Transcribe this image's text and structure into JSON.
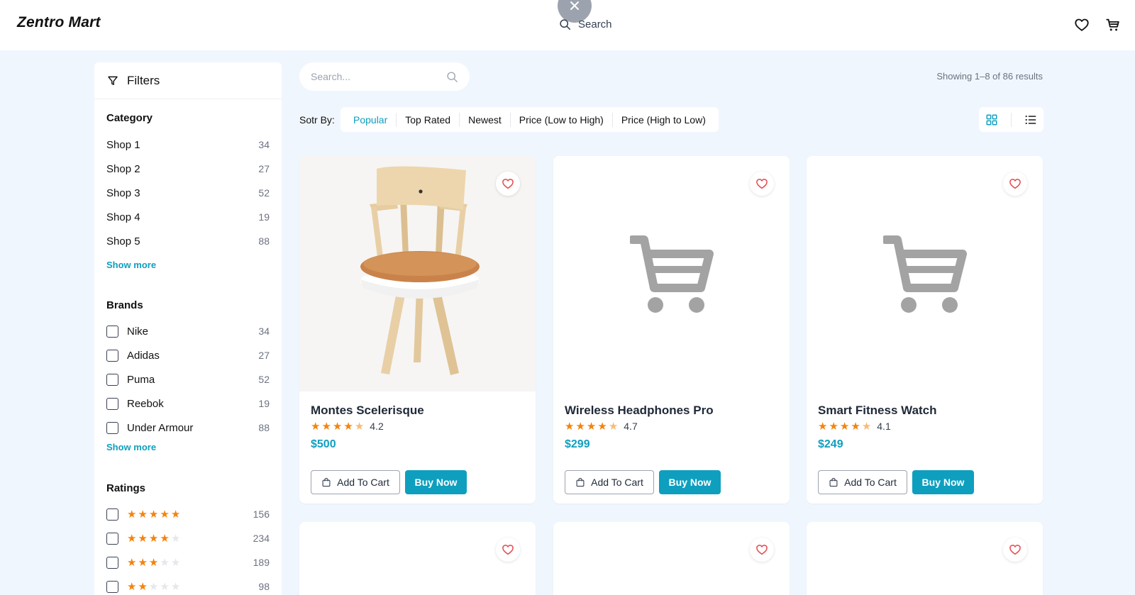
{
  "header": {
    "brand": "Zentro Mart",
    "search_label": "Search"
  },
  "sidebar": {
    "filters_title": "Filters",
    "category": {
      "title": "Category",
      "items": [
        {
          "label": "Shop 1",
          "count": "34"
        },
        {
          "label": "Shop 2",
          "count": "27"
        },
        {
          "label": "Shop 3",
          "count": "52"
        },
        {
          "label": "Shop 4",
          "count": "19"
        },
        {
          "label": "Shop 5",
          "count": "88"
        }
      ],
      "show_more": "Show more"
    },
    "brands": {
      "title": "Brands",
      "items": [
        {
          "label": "Nike",
          "count": "34"
        },
        {
          "label": "Adidas",
          "count": "27"
        },
        {
          "label": "Puma",
          "count": "52"
        },
        {
          "label": "Reebok",
          "count": "19"
        },
        {
          "label": "Under Armour",
          "count": "88"
        }
      ],
      "show_more": "Show more"
    },
    "ratings": {
      "title": "Ratings",
      "items": [
        {
          "stars": 5,
          "count": "156"
        },
        {
          "stars": 4,
          "count": "234"
        },
        {
          "stars": 3,
          "count": "189"
        },
        {
          "stars": 2,
          "count": "98"
        }
      ]
    }
  },
  "toolbar": {
    "search_placeholder": "Search...",
    "results_text": "Showing 1–8 of 86 results",
    "sort_label": "Sotr By:",
    "sort_options": [
      "Popular",
      "Top Rated",
      "Newest",
      "Price (Low to High)",
      "Price (High to Low)"
    ],
    "active_sort": "Popular"
  },
  "products": [
    {
      "name": "Montes Scelerisque",
      "rating": "4.2",
      "price": "$500",
      "image": "chair-photo"
    },
    {
      "name": "Wireless Headphones Pro",
      "rating": "4.7",
      "price": "$299",
      "image": "cart-placeholder"
    },
    {
      "name": "Smart Fitness Watch",
      "rating": "4.1",
      "price": "$249",
      "image": "cart-placeholder"
    }
  ],
  "card_buttons": {
    "add_to_cart": "Add To Cart",
    "buy_now": "Buy Now"
  },
  "colors": {
    "accent": "#0e9fbf",
    "star": "#f5830b",
    "heart": "#e5484d",
    "background": "#f0f6fd"
  }
}
